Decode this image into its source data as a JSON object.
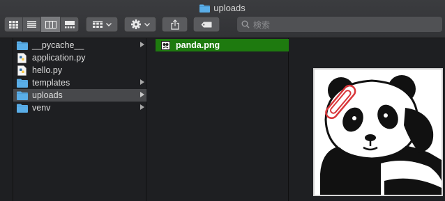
{
  "window": {
    "title": "uploads"
  },
  "toolbar": {
    "view_buttons": [
      {
        "name": "icon-view-button",
        "icon": "icon-grid-icon"
      },
      {
        "name": "list-view-button",
        "icon": "list-icon"
      },
      {
        "name": "column-view-button",
        "icon": "columns-icon",
        "active": true
      },
      {
        "name": "gallery-view-button",
        "icon": "gallery-icon"
      }
    ],
    "search_placeholder": "検索"
  },
  "sidebar_column": {
    "items": [
      {
        "label": "__pycache__",
        "icon": "folder-icon",
        "has_children": true,
        "selected": false
      },
      {
        "label": "application.py",
        "icon": "python-file-icon",
        "has_children": false,
        "selected": false
      },
      {
        "label": "hello.py",
        "icon": "python-file-icon",
        "has_children": false,
        "selected": false
      },
      {
        "label": "templates",
        "icon": "folder-icon",
        "has_children": true,
        "selected": false
      },
      {
        "label": "uploads",
        "icon": "folder-icon",
        "has_children": true,
        "selected": true
      },
      {
        "label": "venv",
        "icon": "folder-icon",
        "has_children": true,
        "selected": false
      }
    ]
  },
  "uploads_column": {
    "items": [
      {
        "label": "panda.png",
        "icon": "image-file-icon",
        "selected": true
      }
    ]
  },
  "preview": {
    "image": "panda-image-preview"
  },
  "colors": {
    "folder": "#5aaee8",
    "selection_green": "#1e7a0f",
    "selection_gray": "#47484b",
    "paperclip": "#d9363a"
  }
}
